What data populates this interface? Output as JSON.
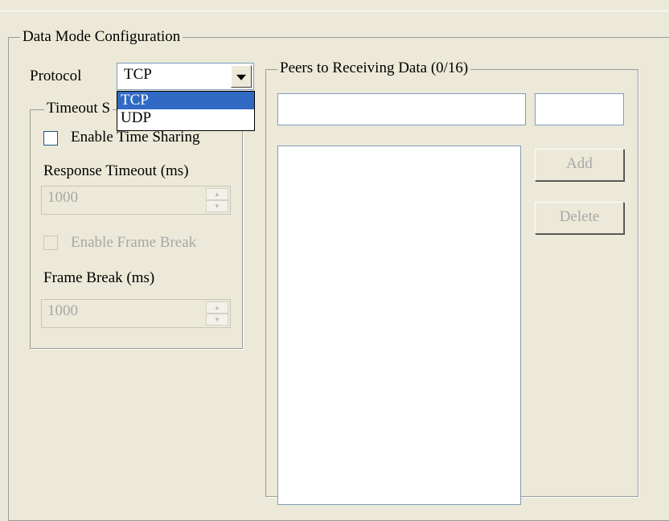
{
  "data_mode_group": {
    "title": "Data Mode Configuration"
  },
  "protocol": {
    "label": "Protocol",
    "selected": "TCP",
    "options": [
      "TCP",
      "UDP"
    ],
    "highlighted_option": "TCP"
  },
  "timeout_group": {
    "title": "Timeout S",
    "enable_time_sharing": {
      "label": "Enable Time Sharing",
      "checked": false
    },
    "response_timeout": {
      "label": "Response Timeout (ms)",
      "value": "1000"
    },
    "enable_frame_break": {
      "label": "Enable Frame Break",
      "checked": false
    },
    "frame_break": {
      "label": "Frame Break (ms)",
      "value": "1000"
    }
  },
  "peers_group": {
    "title": "Peers to Receiving Data (0/16)",
    "ip_value": "",
    "port_value": "",
    "add_label": "Add",
    "delete_label": "Delete",
    "peers": []
  },
  "colors": {
    "window_bg": "#ECE9D8",
    "selection": "#316AC5",
    "input_border": "#7F9DB9",
    "disabled_text": "#A7A7A7"
  }
}
